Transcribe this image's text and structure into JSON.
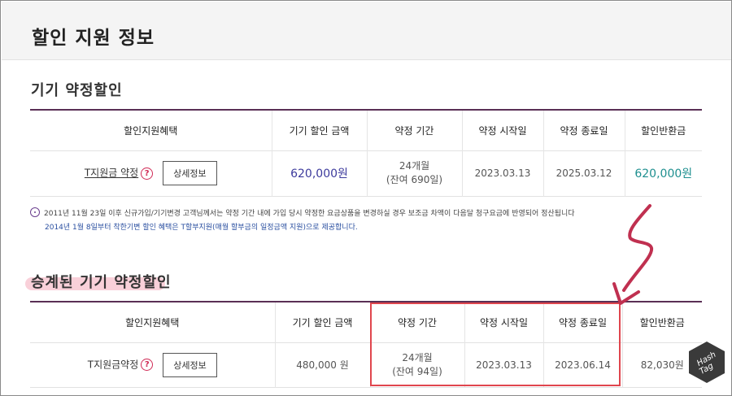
{
  "page": {
    "title": "할인 지원 정보"
  },
  "device_contract": {
    "title": "기기 약정할인",
    "columns": [
      "할인지원혜택",
      "기기 할인 금액",
      "약정 기간",
      "약정 시작일",
      "약정 종료일",
      "할인반환금"
    ],
    "row": {
      "benefit": "T지원금 약정",
      "detail_button": "상세정보",
      "help": "?",
      "discount_amount": "620,000원",
      "period_main": "24개월",
      "period_remaining": "(잔여 690일)",
      "start_date": "2023.03.13",
      "end_date": "2025.03.12",
      "refund": "620,000원"
    }
  },
  "notice": {
    "line1": "2011년 11월 23일 이후 신규가입/기기변경 고객님께서는 약정 기간 내에 가입 당시 약정한 요금상품을 변경하실 경우 보조금 차액이 다음달 청구요금에 반영되어 정산됩니다",
    "line2": "2014년 1월 8일부터 착한기변 할인 혜택은 T할부지원(매월 할부금의 일정금액 지원)으로 제공합니다."
  },
  "inherited_contract": {
    "title": "승계된 기기 약정할인",
    "columns": [
      "할인지원혜택",
      "기기 할인 금액",
      "약정 기간",
      "약정 시작일",
      "약정 종료일",
      "할인반환금"
    ],
    "row": {
      "benefit": "T지원금약정",
      "detail_button": "상세정보",
      "help": "?",
      "discount_amount": "480,000 원",
      "period_main": "24개월",
      "period_remaining": "(잔여 94일)",
      "start_date": "2023.03.13",
      "end_date": "2023.06.14",
      "refund": "82,030원"
    }
  },
  "watermark": {
    "line1": "Hash",
    "line2": "Tag"
  },
  "colors": {
    "table_border": "#5a2f55",
    "amount_blue": "#3c3a9c",
    "refund_teal": "#1e8f8f",
    "annotation_red": "#e0464e",
    "help_red": "#d02a55"
  }
}
